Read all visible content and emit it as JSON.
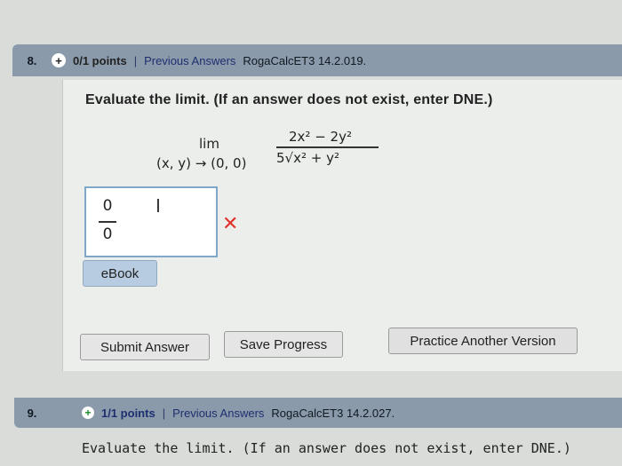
{
  "question8": {
    "number": "8.",
    "status_symbol": "+",
    "points": "0/1 points",
    "separator": "|",
    "previous_answers_link": "Previous Answers",
    "source": "RogaCalcET3 14.2.019.",
    "prompt": "Evaluate the limit. (If an answer does not exist, enter DNE.)",
    "limit": {
      "lim_word": "lim",
      "approach": "(x, y) → (0, 0)",
      "numerator": "2x² − 2y²",
      "denominator": "5√x² + y²"
    },
    "answer": {
      "top": "0",
      "bottom": "0"
    },
    "cursor_glyph": "I",
    "incorrect_mark": "✕",
    "ebook_label": "eBook",
    "submit_label": "Submit Answer",
    "save_label": "Save Progress",
    "practice_label": "Practice Another Version"
  },
  "question9": {
    "number": "9.",
    "status_symbol": "+",
    "points": "1/1 points",
    "separator": "|",
    "previous_answers_link": "Previous Answers",
    "source": "RogaCalcET3 14.2.027.",
    "prompt": "Evaluate the limit. (If an answer does not exist, enter DNE.)"
  },
  "colors": {
    "header_bar": "#8a9aab",
    "incorrect": "#e0322b",
    "correct": "#1e8a2a",
    "ebook_button": "#b7cce0"
  }
}
